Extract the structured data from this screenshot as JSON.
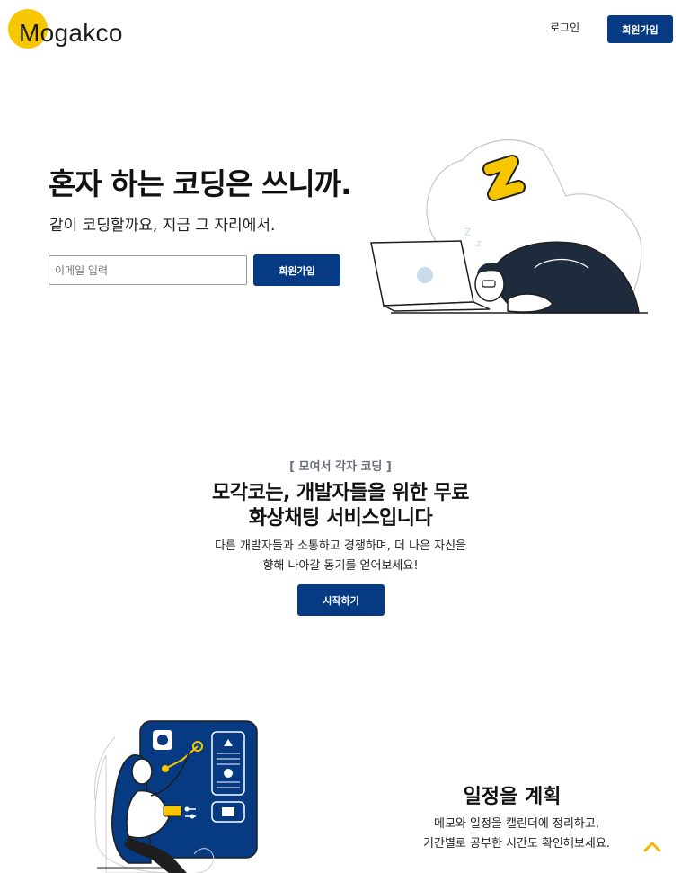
{
  "header": {
    "logo_text": "Mogakco",
    "login_label": "로그인",
    "signup_label": "회원가입"
  },
  "hero": {
    "title": "혼자 하는 코딩은 쓰니까.",
    "subtitle": "같이 코딩할까요, 지금 그 자리에서.",
    "email_placeholder": "이메일 입력",
    "signup_label": "회원가입"
  },
  "intro": {
    "tag": "[ 모여서 각자 코딩 ]",
    "title_line1": "모각코는, 개발자들을 위한 무료",
    "title_line2": "화상채팅 서비스입니다",
    "desc_line1": "다른 개발자들과 소통하고 경쟁하며, 더 나은 자신을",
    "desc_line2": "향해 나아갈 동기를 얻어보세요!",
    "start_label": "시작하기"
  },
  "plan": {
    "title": "일정을 계획",
    "desc_line1": "메모와 일정을 캘린더에 정리하고,",
    "desc_line2": "기간별로 공부한 시간도 확인해보세요."
  },
  "colors": {
    "brand_navy": "#063a83",
    "brand_yellow": "#f7c600",
    "tag_gray": "#6b6e7a"
  },
  "icons": {
    "scroll_top": "chevron-up-icon"
  }
}
